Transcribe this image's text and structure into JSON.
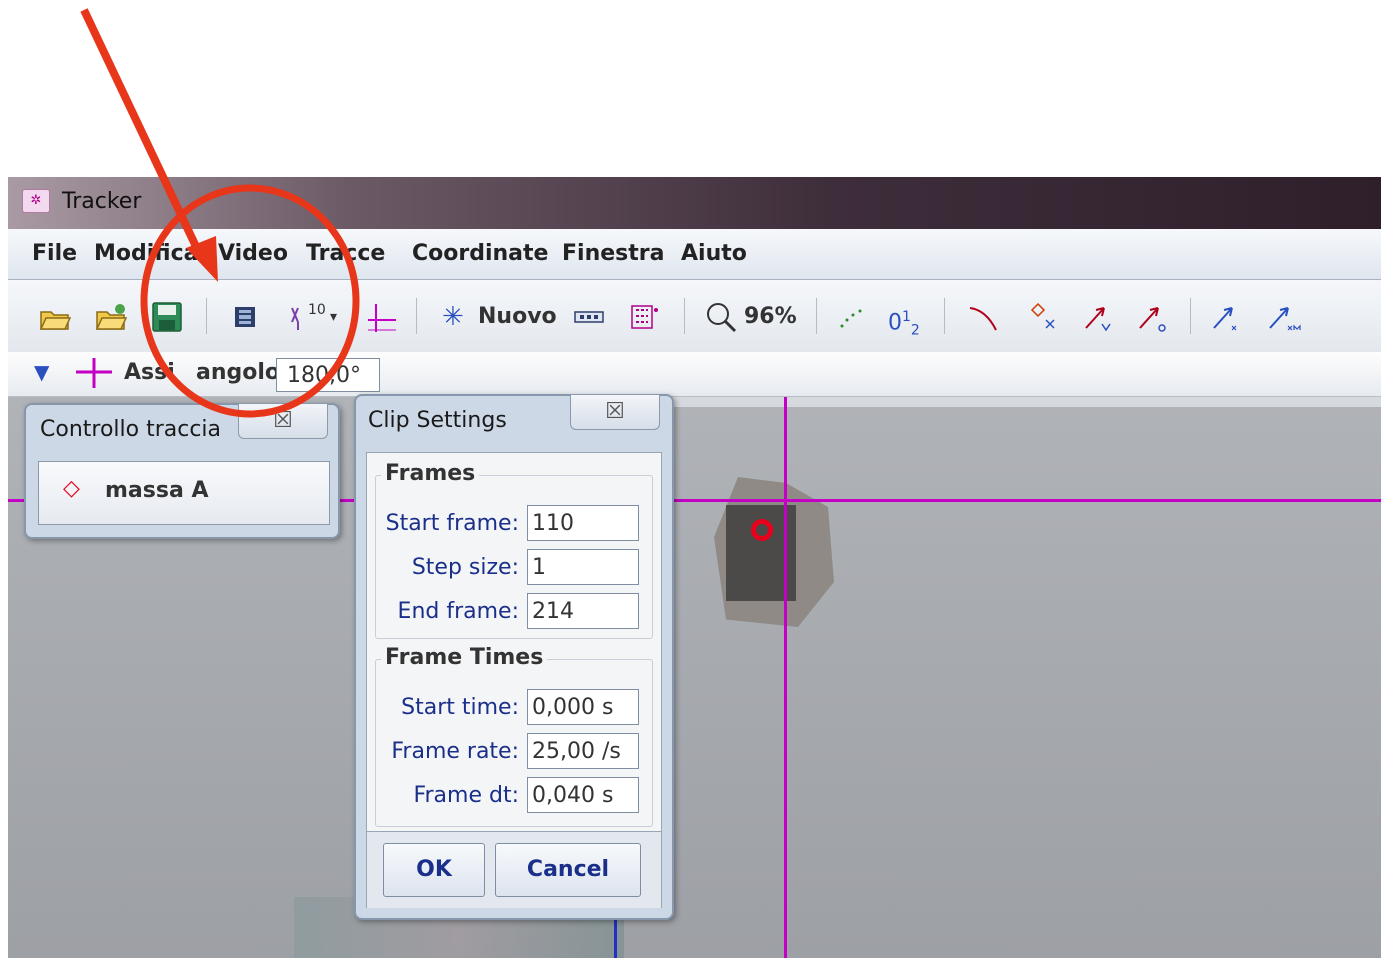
{
  "window": {
    "title": "Tracker"
  },
  "menu": [
    "File",
    "Modifica",
    "Video",
    "Tracce",
    "Coordinate",
    "Finestra",
    "Aiuto"
  ],
  "toolbar": {
    "new_track_label": "Nuovo",
    "zoom_label": "96%",
    "step_icon_text": "10",
    "frame_icon_text_main": "0",
    "frame_icon_text_sup": "1",
    "frame_icon_text_sub": "2",
    "icons": [
      "open-icon",
      "open-library-icon",
      "save-icon",
      "clip-settings-icon",
      "points-dropdown-icon",
      "axes-icon",
      "new-track-icon",
      "calibration-icon",
      "tracks-icon",
      "zoom-icon",
      "trails-icon",
      "frame-numbers-icon",
      "path-icon",
      "marker-icon",
      "velocity-icon",
      "acceleration-icon",
      "x1-vector-icon",
      "xm-vector-icon"
    ]
  },
  "trackbar": {
    "track_name": "Assi",
    "angle_label": "angolo",
    "angle_value": "180,0°"
  },
  "track_control": {
    "title": "Controllo traccia",
    "close_glyph": "☒",
    "item_label": "massa A"
  },
  "clip_settings": {
    "title": "Clip Settings",
    "close_glyph": "☒",
    "frames_group": "Frames",
    "start_frame_label": "Start frame:",
    "start_frame_value": "110",
    "step_size_label": "Step size:",
    "step_size_value": "1",
    "end_frame_label": "End frame:",
    "end_frame_value": "214",
    "times_group": "Frame Times",
    "start_time_label": "Start time:",
    "start_time_value": "0,000 s",
    "frame_rate_label": "Frame rate:",
    "frame_rate_value": "25,00 /s",
    "frame_dt_label": "Frame dt:",
    "frame_dt_value": "0,040 s",
    "ok_label": "OK",
    "cancel_label": "Cancel"
  },
  "colors": {
    "annotation": "#e8361a",
    "axes": "#c400c4",
    "origin_marker": "#e8001c"
  }
}
